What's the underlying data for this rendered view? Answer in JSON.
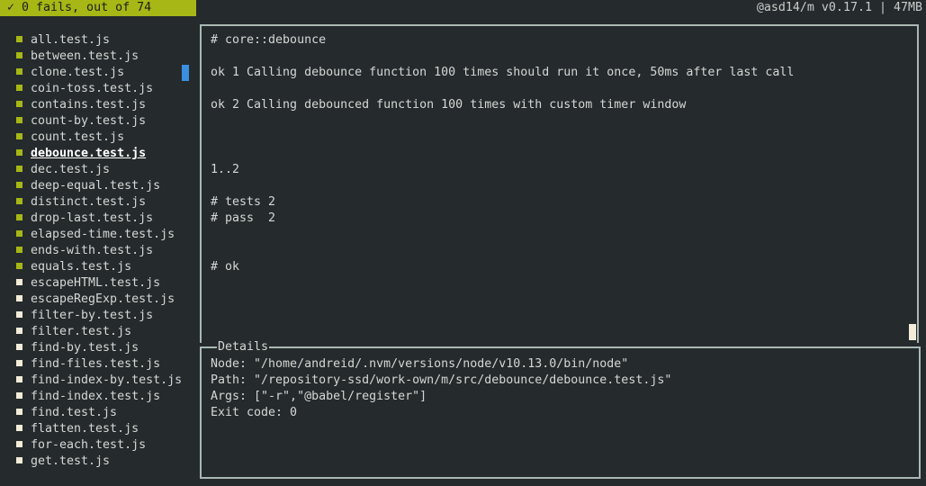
{
  "topbar": {
    "status_text": "✓ 0 fails, out of 74",
    "app_info": "@asd14/m v0.17.1 | 47MB"
  },
  "colors": {
    "pass": "#a6b716",
    "pending": "#f2ecd8",
    "accent": "#3a8fe0",
    "border": "#a9b9b2",
    "background": "#252a2d"
  },
  "files": [
    {
      "name": "all.test.js",
      "status": "pass"
    },
    {
      "name": "between.test.js",
      "status": "pass"
    },
    {
      "name": "clone.test.js",
      "status": "pass"
    },
    {
      "name": "coin-toss.test.js",
      "status": "pass"
    },
    {
      "name": "contains.test.js",
      "status": "pass"
    },
    {
      "name": "count-by.test.js",
      "status": "pass"
    },
    {
      "name": "count.test.js",
      "status": "pass"
    },
    {
      "name": "debounce.test.js",
      "status": "pass",
      "active": true
    },
    {
      "name": "dec.test.js",
      "status": "pass"
    },
    {
      "name": "deep-equal.test.js",
      "status": "pass"
    },
    {
      "name": "distinct.test.js",
      "status": "pass"
    },
    {
      "name": "drop-last.test.js",
      "status": "pass"
    },
    {
      "name": "elapsed-time.test.js",
      "status": "pass"
    },
    {
      "name": "ends-with.test.js",
      "status": "pass"
    },
    {
      "name": "equals.test.js",
      "status": "pass"
    },
    {
      "name": "escapeHTML.test.js",
      "status": "pending"
    },
    {
      "name": "escapeRegExp.test.js",
      "status": "pending"
    },
    {
      "name": "filter-by.test.js",
      "status": "pending"
    },
    {
      "name": "filter.test.js",
      "status": "pending"
    },
    {
      "name": "find-by.test.js",
      "status": "pending"
    },
    {
      "name": "find-files.test.js",
      "status": "pending"
    },
    {
      "name": "find-index-by.test.js",
      "status": "pending"
    },
    {
      "name": "find-index.test.js",
      "status": "pending"
    },
    {
      "name": "find.test.js",
      "status": "pending"
    },
    {
      "name": "flatten.test.js",
      "status": "pending"
    },
    {
      "name": "for-each.test.js",
      "status": "pending"
    },
    {
      "name": "get.test.js",
      "status": "pending"
    }
  ],
  "output": {
    "lines": [
      {
        "row": 0,
        "text": "# core::debounce"
      },
      {
        "row": 2,
        "text": "ok 1 Calling debounce function 100 times should run it once, 50ms after last call"
      },
      {
        "row": 4,
        "text": "ok 2 Calling debounced function 100 times with custom timer window"
      },
      {
        "row": 8,
        "text": "1..2"
      },
      {
        "row": 10,
        "text": "# tests 2"
      },
      {
        "row": 11,
        "text": "# pass  2"
      },
      {
        "row": 14,
        "text": "# ok"
      }
    ]
  },
  "details": {
    "title": "Details",
    "node": "Node: \"/home/andreid/.nvm/versions/node/v10.13.0/bin/node\"",
    "path": "Path: \"/repository-ssd/work-own/m/src/debounce/debounce.test.js\"",
    "args": "Args: [\"-r\",\"@babel/register\"]",
    "exit_code": "Exit code: 0"
  }
}
